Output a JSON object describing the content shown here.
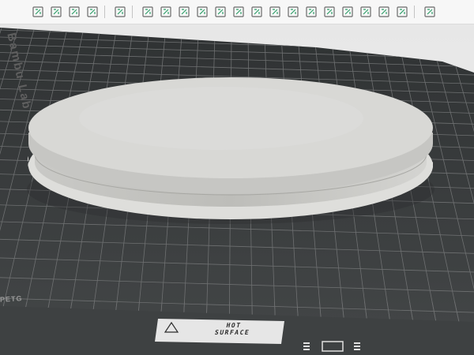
{
  "toolbar": {
    "groups": [
      [
        "add-cube-icon",
        "grid-arrange-icon",
        "orient-icon",
        "plate-layout-icon"
      ],
      [
        "split-icon"
      ],
      [
        "move-icon",
        "rotate-icon",
        "scale-icon",
        "cut-icon",
        "copy-icon",
        "paint-icon",
        "support-paint-icon",
        "text-icon",
        "measure-icon",
        "assembly-icon",
        "boolean-icon",
        "variable-layer-icon",
        "seam-icon",
        "fdm-supports-icon",
        "edit-icon"
      ],
      [
        "view-settings-icon"
      ]
    ]
  },
  "plate": {
    "brand_text": "Bambu Lab",
    "surface_text": "PETG",
    "warning_lines": [
      "HOT",
      "SURFACE"
    ]
  },
  "colors": {
    "toolbar_bg": "#f7f7f7",
    "plate_dark": "#3a3d3e",
    "grid_line": "#6e7071",
    "model_top": "#d8d8d5",
    "model_side": "#b8b8b4"
  }
}
